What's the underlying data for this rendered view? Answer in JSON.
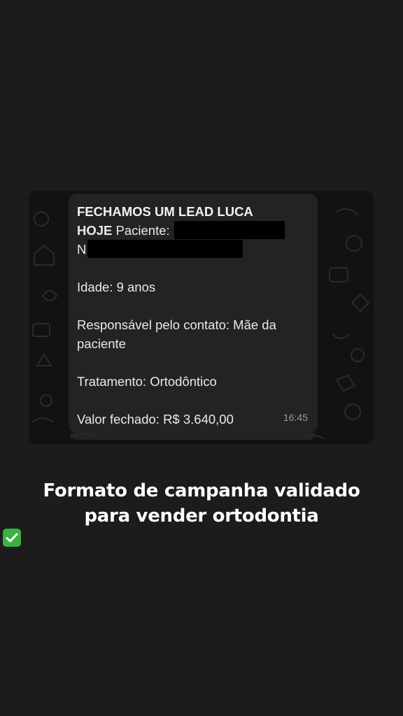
{
  "message": {
    "headline_line1": "FECHAMOS UM LEAD LUCA",
    "headline_line2_bold": "HOJE",
    "patient_label": "Paciente:",
    "name_prefix": "N",
    "age": "Idade: 9 anos",
    "responsible": "Responsável pelo contato: Mãe da paciente",
    "treatment": "Tratamento: Ortodôntico",
    "value": "Valor fechado: R$ 3.640,00",
    "time": "16:45"
  },
  "caption": {
    "line1": "Formato de campanha validado",
    "line2": "para vender ortodontia"
  },
  "icons": {
    "caption_emoji": "check-mark-button-icon",
    "background": "chat-doodle-wallpaper"
  },
  "colors": {
    "page_bg": "#1c1c1c",
    "chat_bg": "#121212",
    "bubble_bg": "#232325",
    "emoji_green": "#3cb043"
  }
}
